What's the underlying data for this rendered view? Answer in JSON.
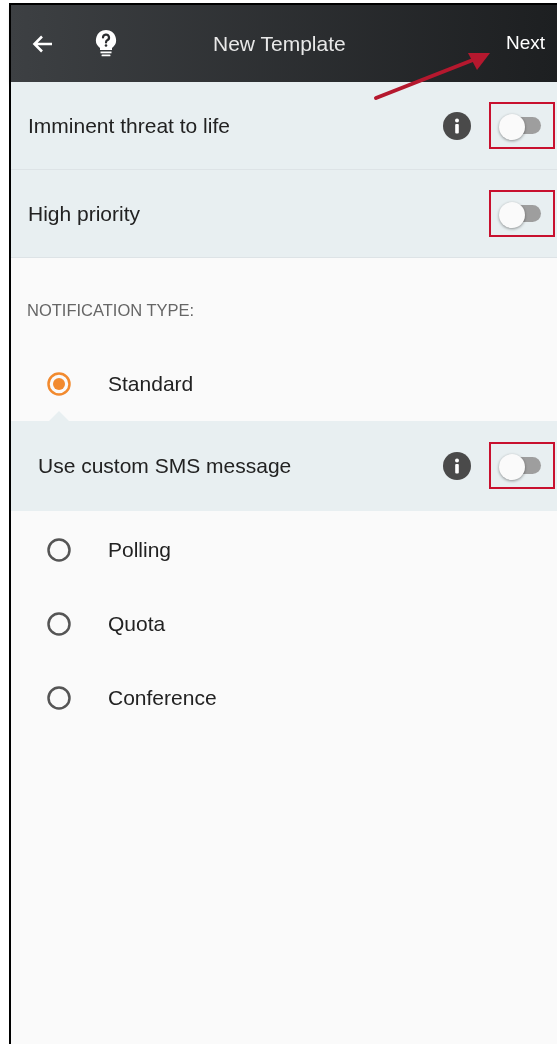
{
  "header": {
    "title": "New Template",
    "action": "Next"
  },
  "toggles": [
    {
      "label": "Imminent threat to life",
      "info": true,
      "on": false,
      "highlighted": true
    },
    {
      "label": "High priority",
      "info": false,
      "on": false,
      "highlighted": true
    }
  ],
  "notification_type": {
    "heading": "NOTIFICATION TYPE:",
    "options": [
      {
        "label": "Standard",
        "selected": true,
        "sub_toggle": {
          "label": "Use custom SMS message",
          "info": true,
          "on": false,
          "highlighted": true
        }
      },
      {
        "label": "Polling",
        "selected": false
      },
      {
        "label": "Quota",
        "selected": false
      },
      {
        "label": "Conference",
        "selected": false
      }
    ]
  }
}
